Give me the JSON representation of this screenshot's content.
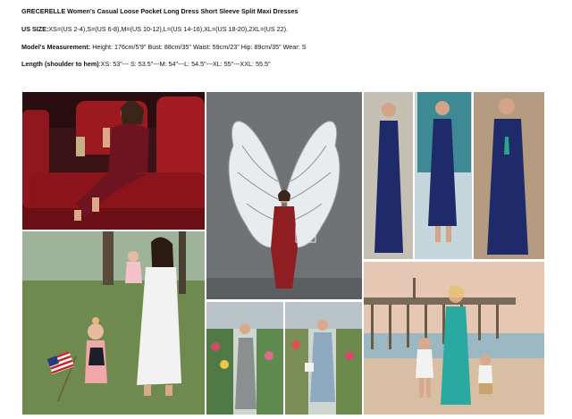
{
  "product": {
    "title": "GRECERELLE Women's Casual Loose Pocket Long Dress Short Sleeve Split Maxi Dresses"
  },
  "specs": {
    "size_label": "US SIZE:",
    "size_value": "XS=(US 2-4),S=(US 6-8),M=(US 10-12),L=(US 14-16),XL=(US 18-20),2XL=(US 22).",
    "model_label": "Model's Measurement:",
    "model_value": " Height: 176cm/5'9\" Bust: 88cm/35\" Waist: 59cm/23\" Hip: 89cm/35\" Wear: S",
    "length_label": "Length (shoulder to hem)",
    "length_value": ":XS: 53\"--- S: 53.5\"---M: 54\"---L: 54.5\"---XL: 55\"---XXL: 55.5\""
  },
  "photos": [
    {
      "name": "photo-cinema-seat",
      "dress_color": "#6e1420"
    },
    {
      "name": "photo-angel-wings-mural",
      "dress_color": "#8f1e22"
    },
    {
      "name": "photo-navy-dress-collage",
      "dress_color": "#1e2a6a"
    },
    {
      "name": "photo-white-dress-park",
      "dress_color": "#f2f2f2"
    },
    {
      "name": "photo-garden-center",
      "dress_color": "#8a8f90"
    },
    {
      "name": "photo-beach-pier",
      "dress_color": "#2aa9a0"
    }
  ]
}
